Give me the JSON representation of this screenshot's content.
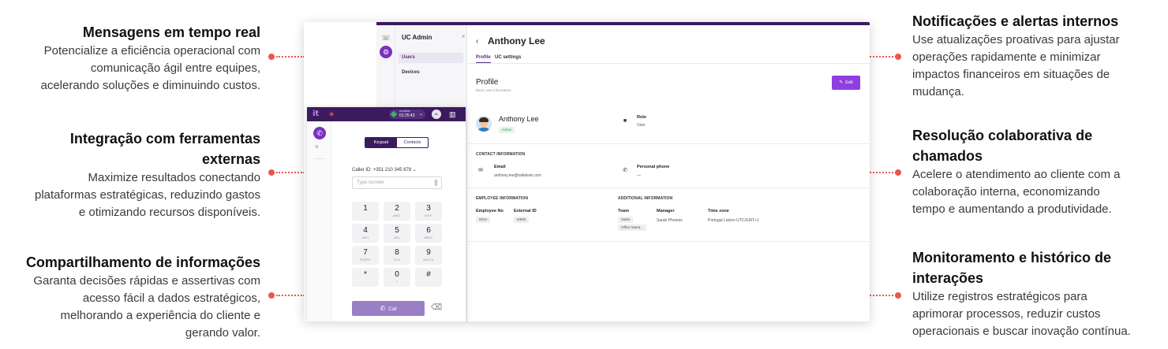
{
  "features_left": [
    {
      "title": "Mensagens em tempo real",
      "lines": [
        "Potencialize a eficiência operacional com",
        "comunicação ágil entre equipes,",
        "acelerando soluções e diminuindo custos."
      ]
    },
    {
      "title": "Integração com ferramentas externas",
      "title_lines": [
        "Integração com ferramentas",
        "externas"
      ],
      "lines": [
        "Maximize resultados conectando",
        "plataformas estratégicas, reduzindo gastos",
        "e otimizando recursos disponíveis."
      ]
    },
    {
      "title": "Compartilhamento de informações",
      "lines": [
        "Garanta decisões rápidas e assertivas com",
        "acesso fácil a dados estratégicos,",
        "melhorando a experiência do cliente e",
        "gerando valor."
      ]
    }
  ],
  "features_right": [
    {
      "title": "Notificações e alertas internos",
      "lines": [
        "Use atualizações proativas para ajustar",
        "operações rapidamente e minimizar",
        "impactos financeiros em situações de",
        "mudança."
      ]
    },
    {
      "title_lines": [
        "Resolução colaborativa de",
        "chamados"
      ],
      "lines": [
        "Acelere o atendimento ao cliente com a",
        "colaboração interna, economizando",
        "tempo e aumentando a produtividade."
      ]
    },
    {
      "title_lines": [
        "Monitoramento e histórico de",
        "interações"
      ],
      "lines": [
        "Utilize registros estratégicos para",
        "aprimorar processos, reduzir custos",
        "operacionais e buscar inovação contínua."
      ]
    }
  ],
  "colors": {
    "accent_purple": "#8f3ee0",
    "dark_purple": "#3b1b5e",
    "connector": "#e8584a",
    "status_green": "#3bb36a"
  },
  "admin": {
    "sidebar_title": "UC Admin",
    "collapse_icon": "chevron-left-double-icon",
    "menu": [
      "Users",
      "Devices"
    ],
    "back_icon": "chevron-left-icon",
    "user_name": "Anthony Lee",
    "tabs": [
      "Profile",
      "UC settings"
    ],
    "section_title": "Profile",
    "section_subtitle": "Basic user information",
    "edit_label": "Edit",
    "profile": {
      "name": "Anthony Lee",
      "status": "Active",
      "role_label": "Role",
      "role_value": "User"
    },
    "contact": {
      "header": "CONTACT INFORMATION",
      "email_label": "Email",
      "email_value": "anthony.lee@talkdesk.com",
      "phone_label": "Personal phone",
      "phone_value": "—"
    },
    "employee": {
      "header": "EMPLOYEE INFORMATION",
      "emp_no_label": "Employee No",
      "emp_no_value": "0044",
      "ext_id_label": "External ID",
      "ext_id_value": "6/890"
    },
    "additional": {
      "header": "ADDITIONAL INFORMATION",
      "team_label": "Team",
      "team_values": [
        "Sales",
        "Office Mana..."
      ],
      "manager_label": "Manager",
      "manager_value": "Sarah Phoenix",
      "tz_label": "Time zone",
      "tz_value": "Portugal Lisbon UTC/GMT+1"
    }
  },
  "softphone": {
    "logo": "it",
    "status_label": "Available",
    "status_time": "01:25:43",
    "avatar_initials": "AL",
    "tabs": [
      "Keypad",
      "Contacts"
    ],
    "caller_id_label": "Caller ID:",
    "caller_id_value": "+351 210 345 678",
    "number_placeholder": "Type number",
    "keys": [
      {
        "d": "1",
        "l": ""
      },
      {
        "d": "2",
        "l": "ABC"
      },
      {
        "d": "3",
        "l": "DEF"
      },
      {
        "d": "4",
        "l": "GHI"
      },
      {
        "d": "5",
        "l": "JKL"
      },
      {
        "d": "6",
        "l": "MNO"
      },
      {
        "d": "7",
        "l": "PQRS"
      },
      {
        "d": "8",
        "l": "TUV"
      },
      {
        "d": "9",
        "l": "WXYZ"
      },
      {
        "d": "*",
        "l": ""
      },
      {
        "d": "0",
        "l": "+"
      },
      {
        "d": "#",
        "l": ""
      }
    ],
    "call_label": "Call"
  }
}
